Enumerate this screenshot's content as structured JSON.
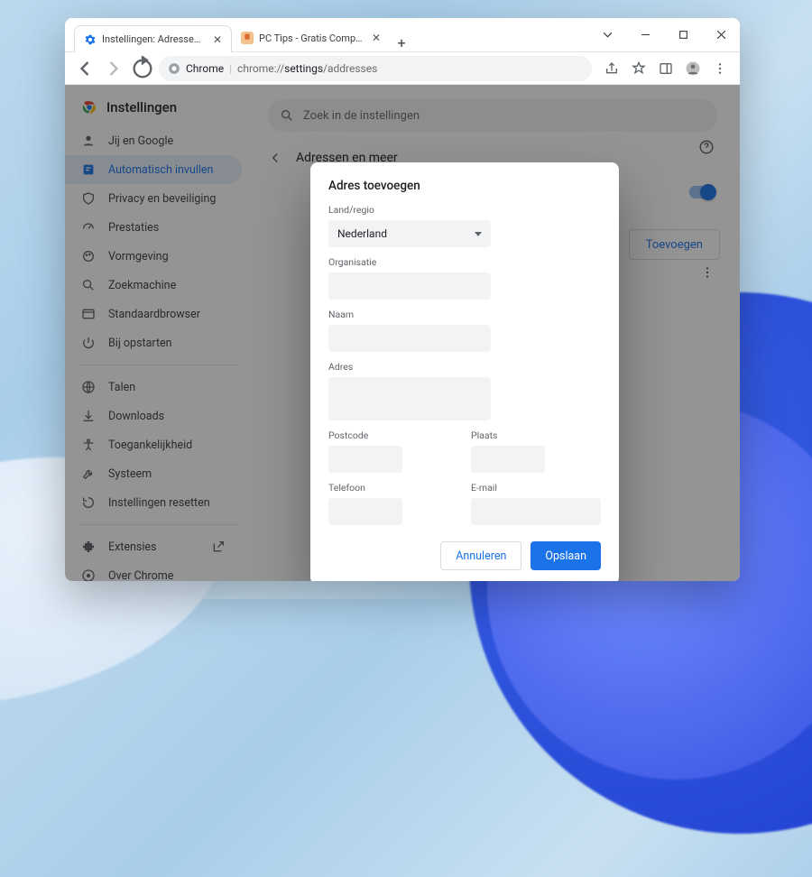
{
  "window": {
    "tabs": [
      {
        "label": "Instellingen: Adressen en meer",
        "active": true
      },
      {
        "label": "PC Tips - Gratis Computer Tips, v",
        "active": false
      }
    ]
  },
  "addressbar": {
    "chrome_label": "Chrome",
    "url_prefix": "chrome://",
    "url_main": "settings",
    "url_suffix": "/addresses"
  },
  "settings": {
    "title": "Instellingen",
    "search_placeholder": "Zoek in de instellingen",
    "nav": [
      {
        "id": "you-google",
        "label": "Jij en Google"
      },
      {
        "id": "autofill",
        "label": "Automatisch invullen",
        "active": true
      },
      {
        "id": "privacy",
        "label": "Privacy en beveiliging"
      },
      {
        "id": "performance",
        "label": "Prestaties"
      },
      {
        "id": "appearance",
        "label": "Vormgeving"
      },
      {
        "id": "search",
        "label": "Zoekmachine"
      },
      {
        "id": "default",
        "label": "Standaardbrowser"
      },
      {
        "id": "startup",
        "label": "Bij opstarten"
      }
    ],
    "nav2": [
      {
        "id": "languages",
        "label": "Talen"
      },
      {
        "id": "downloads",
        "label": "Downloads"
      },
      {
        "id": "accessibility",
        "label": "Toegankelijkheid"
      },
      {
        "id": "system",
        "label": "Systeem"
      },
      {
        "id": "reset",
        "label": "Instellingen resetten"
      }
    ],
    "nav3": [
      {
        "id": "extensions",
        "label": "Extensies"
      },
      {
        "id": "about",
        "label": "Over Chrome"
      }
    ],
    "breadcrumb": "Adressen en meer",
    "add_button": "Toevoegen"
  },
  "dialog": {
    "title": "Adres toevoegen",
    "fields": {
      "country_label": "Land/regio",
      "country_value": "Nederland",
      "org_label": "Organisatie",
      "name_label": "Naam",
      "address_label": "Adres",
      "postcode_label": "Postcode",
      "city_label": "Plaats",
      "phone_label": "Telefoon",
      "email_label": "E-mail"
    },
    "actions": {
      "cancel": "Annuleren",
      "save": "Opslaan"
    }
  }
}
